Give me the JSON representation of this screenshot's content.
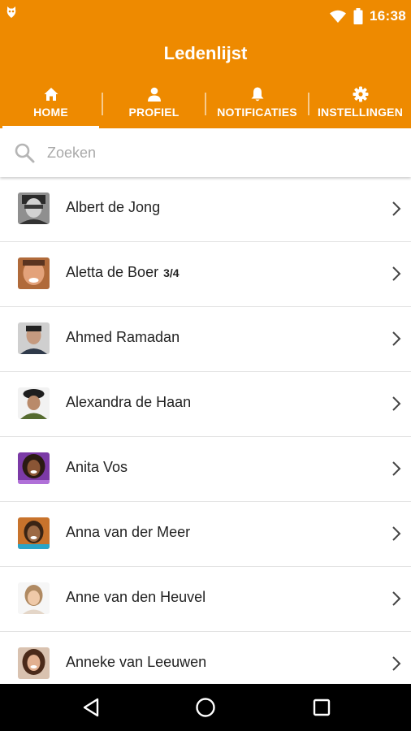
{
  "status_bar": {
    "time": "16:38",
    "icons": [
      "app-notification-icon",
      "wifi-icon",
      "battery-icon"
    ]
  },
  "app_bar": {
    "title": "Ledenlijst",
    "color": "#EE8A00"
  },
  "tabs": [
    {
      "label": "HOME",
      "icon": "home-icon",
      "active": true
    },
    {
      "label": "PROFIEL",
      "icon": "person-icon",
      "active": false
    },
    {
      "label": "NOTIFICATIES",
      "icon": "bell-icon",
      "active": false
    },
    {
      "label": "INSTELLINGEN",
      "icon": "gear-icon",
      "active": false
    }
  ],
  "search": {
    "placeholder": "Zoeken",
    "value": ""
  },
  "members": [
    {
      "name": "Albert de Jong",
      "badge": ""
    },
    {
      "name": "Aletta de Boer",
      "badge": "3/4"
    },
    {
      "name": "Ahmed Ramadan",
      "badge": ""
    },
    {
      "name": "Alexandra de Haan",
      "badge": ""
    },
    {
      "name": "Anita Vos",
      "badge": ""
    },
    {
      "name": "Anna van der Meer",
      "badge": ""
    },
    {
      "name": "Anne van den Heuvel",
      "badge": ""
    },
    {
      "name": "Anneke van Leeuwen",
      "badge": ""
    }
  ],
  "nav_bar": {
    "buttons": [
      "back-icon",
      "home-circle-icon",
      "recents-icon"
    ]
  }
}
